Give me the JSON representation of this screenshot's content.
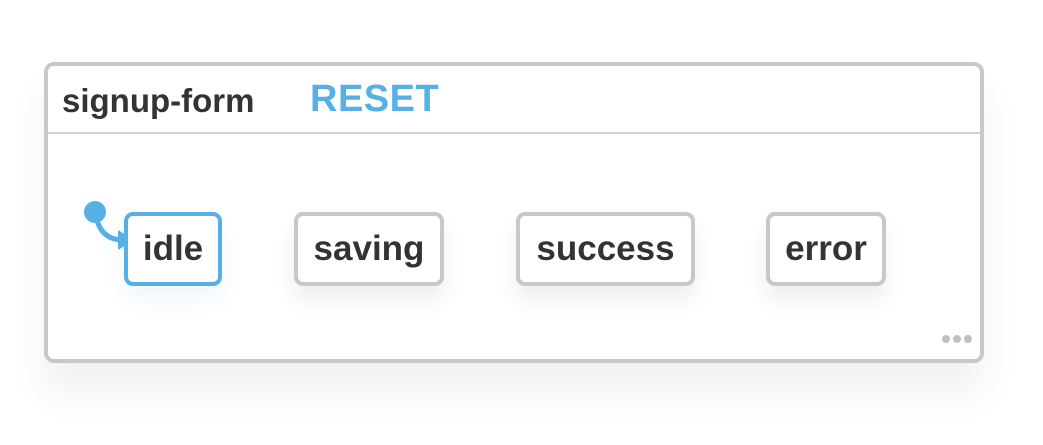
{
  "machine": {
    "title": "signup-form",
    "reset_label": "RESET",
    "initial_state": "idle",
    "active_state": "idle",
    "states": [
      {
        "label": "idle"
      },
      {
        "label": "saving"
      },
      {
        "label": "success"
      },
      {
        "label": "error"
      }
    ],
    "more_icon": "more-horizontal-icon"
  },
  "colors": {
    "accent": "#56b0e6",
    "border": "#c8c8c8",
    "text": "#333333"
  }
}
